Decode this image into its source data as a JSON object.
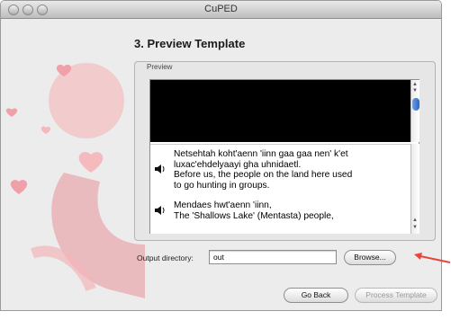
{
  "window": {
    "title": "CuPED"
  },
  "step_title": "3. Preview Template",
  "preview": {
    "group_label": "Preview",
    "entries": [
      {
        "lines": [
          "Netsehtah koht'aenn 'iinn gaa gaa nen' k'et",
          "luxac'ehdelyaayi gha uhnidaetl.",
          "Before us, the people on the land here used",
          "to go hunting in groups."
        ]
      },
      {
        "lines": [
          "Mendaes hwt'aenn 'iinn,",
          "The 'Shallows Lake' (Mentasta) people,"
        ]
      }
    ]
  },
  "output": {
    "label": "Output directory:",
    "value": "out"
  },
  "buttons": {
    "browse": "Browse...",
    "go_back": "Go Back",
    "process": "Process Template"
  },
  "colors": {
    "accent_arrow": "#e8453c",
    "decor_pink": "#f0b8bb",
    "decor_heart": "#f0a0a8"
  },
  "icons": [
    "speaker-icon"
  ]
}
